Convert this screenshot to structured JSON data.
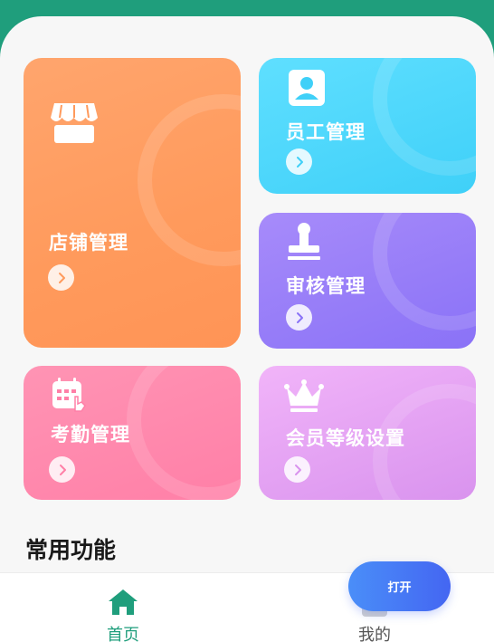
{
  "cards": {
    "store": {
      "title": "店铺管理",
      "icon": "storefront-icon",
      "color": "#ff9a5c"
    },
    "staff": {
      "title": "员工管理",
      "icon": "employee-icon",
      "color": "#3fd0f8"
    },
    "audit": {
      "title": "审核管理",
      "icon": "stamp-icon",
      "color": "#8a72f7"
    },
    "attendance": {
      "title": "考勤管理",
      "icon": "calendar-icon",
      "color": "#ff7fa7"
    },
    "member": {
      "title": "会员等级设置",
      "icon": "crown-icon",
      "color": "#d993ee"
    }
  },
  "section": {
    "title": "常用功能"
  },
  "floating": {
    "open_label": "打开"
  },
  "nav": {
    "home": {
      "label": "首页",
      "icon": "home-icon",
      "active": true,
      "color": "#1f9e7c"
    },
    "mine": {
      "label": "我的",
      "icon": "profile-icon",
      "active": false
    }
  },
  "colors": {
    "brand": "#1f9e7c",
    "button": "#4466f2"
  }
}
